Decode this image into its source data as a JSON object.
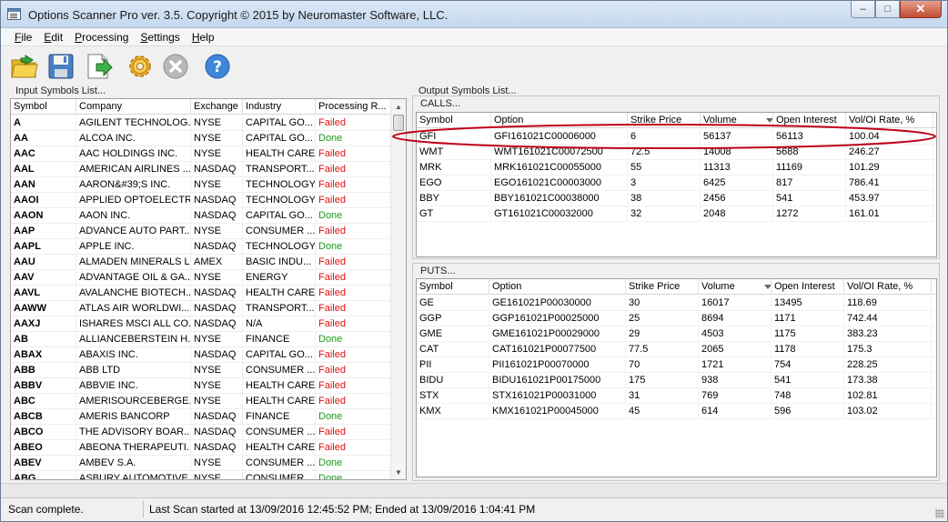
{
  "window": {
    "title": "Options Scanner Pro ver. 3.5. Copyright © 2015 by Neuromaster Software, LLC.",
    "controls": {
      "minimize": "–",
      "maximize": "□",
      "close": "✕"
    }
  },
  "menu": [
    {
      "ul": "F",
      "rest": "ile"
    },
    {
      "ul": "E",
      "rest": "dit"
    },
    {
      "ul": "P",
      "rest": "rocessing"
    },
    {
      "ul": "S",
      "rest": "ettings"
    },
    {
      "ul": "H",
      "rest": "elp"
    }
  ],
  "toolbar": [
    "open-folder-icon",
    "save-icon",
    "export-icon",
    "settings-gear-icon",
    "stop-icon",
    "help-icon"
  ],
  "input_panel": {
    "label": "Input Symbols List...",
    "columns": [
      "Symbol",
      "Company",
      "Exchange",
      "Industry",
      "Processing R..."
    ],
    "rows": [
      [
        "A",
        "AGILENT TECHNOLOG...",
        "NYSE",
        "CAPITAL GO...",
        "Failed"
      ],
      [
        "AA",
        "ALCOA INC.",
        "NYSE",
        "CAPITAL GO...",
        "Done"
      ],
      [
        "AAC",
        "AAC HOLDINGS INC.",
        "NYSE",
        "HEALTH CARE",
        "Failed"
      ],
      [
        "AAL",
        "AMERICAN AIRLINES ...",
        "NASDAQ",
        "TRANSPORT...",
        "Failed"
      ],
      [
        "AAN",
        "AARON&#39;S INC.",
        "NYSE",
        "TECHNOLOGY",
        "Failed"
      ],
      [
        "AAOI",
        "APPLIED OPTOELECTR...",
        "NASDAQ",
        "TECHNOLOGY",
        "Failed"
      ],
      [
        "AAON",
        "AAON INC.",
        "NASDAQ",
        "CAPITAL GO...",
        "Done"
      ],
      [
        "AAP",
        "ADVANCE AUTO PART...",
        "NYSE",
        "CONSUMER ...",
        "Failed"
      ],
      [
        "AAPL",
        "APPLE INC.",
        "NASDAQ",
        "TECHNOLOGY",
        "Done"
      ],
      [
        "AAU",
        "ALMADEN MINERALS L...",
        "AMEX",
        "BASIC INDU...",
        "Failed"
      ],
      [
        "AAV",
        "ADVANTAGE OIL & GA...",
        "NYSE",
        "ENERGY",
        "Failed"
      ],
      [
        "AAVL",
        "AVALANCHE BIOTECH...",
        "NASDAQ",
        "HEALTH CARE",
        "Failed"
      ],
      [
        "AAWW",
        "ATLAS AIR WORLDWI...",
        "NASDAQ",
        "TRANSPORT...",
        "Failed"
      ],
      [
        "AAXJ",
        "ISHARES MSCI ALL CO...",
        "NASDAQ",
        "N/A",
        "Failed"
      ],
      [
        "AB",
        "ALLIANCEBERSTEIN H...",
        "NYSE",
        "FINANCE",
        "Done"
      ],
      [
        "ABAX",
        "ABAXIS INC.",
        "NASDAQ",
        "CAPITAL GO...",
        "Failed"
      ],
      [
        "ABB",
        "ABB LTD",
        "NYSE",
        "CONSUMER ...",
        "Failed"
      ],
      [
        "ABBV",
        "ABBVIE INC.",
        "NYSE",
        "HEALTH CARE",
        "Failed"
      ],
      [
        "ABC",
        "AMERISOURCEBERGE...",
        "NYSE",
        "HEALTH CARE",
        "Failed"
      ],
      [
        "ABCB",
        "AMERIS BANCORP",
        "NASDAQ",
        "FINANCE",
        "Done"
      ],
      [
        "ABCO",
        "THE ADVISORY BOAR...",
        "NASDAQ",
        "CONSUMER ...",
        "Failed"
      ],
      [
        "ABEO",
        "ABEONA THERAPEUTI...",
        "NASDAQ",
        "HEALTH CARE",
        "Failed"
      ],
      [
        "ABEV",
        "AMBEV S.A.",
        "NYSE",
        "CONSUMER ...",
        "Done"
      ],
      [
        "ABG",
        "ASBURY AUTOMOTIVE ...",
        "NYSE",
        "CONSUMER ...",
        "Done"
      ]
    ]
  },
  "output_panel": {
    "label": "Output Symbols List...",
    "calls": {
      "label": "CALLS...",
      "columns": [
        "Symbol",
        "Option",
        "Strike Price",
        "Volume",
        "Open Interest",
        "Vol/OI Rate, %"
      ],
      "rows": [
        [
          "GFI",
          "GFI161021C00006000",
          "6",
          "56137",
          "56113",
          "100.04"
        ],
        [
          "WMT",
          "WMT161021C00072500",
          "72.5",
          "14008",
          "5688",
          "246.27"
        ],
        [
          "MRK",
          "MRK161021C00055000",
          "55",
          "11313",
          "11169",
          "101.29"
        ],
        [
          "EGO",
          "EGO161021C00003000",
          "3",
          "6425",
          "817",
          "786.41"
        ],
        [
          "BBY",
          "BBY161021C00038000",
          "38",
          "2456",
          "541",
          "453.97"
        ],
        [
          "GT",
          "GT161021C00032000",
          "32",
          "2048",
          "1272",
          "161.01"
        ]
      ]
    },
    "puts": {
      "label": "PUTS...",
      "columns": [
        "Symbol",
        "Option",
        "Strike Price",
        "Volume",
        "Open Interest",
        "Vol/OI Rate, %"
      ],
      "rows": [
        [
          "GE",
          "GE161021P00030000",
          "30",
          "16017",
          "13495",
          "118.69"
        ],
        [
          "GGP",
          "GGP161021P00025000",
          "25",
          "8694",
          "1171",
          "742.44"
        ],
        [
          "GME",
          "GME161021P00029000",
          "29",
          "4503",
          "1175",
          "383.23"
        ],
        [
          "CAT",
          "CAT161021P00077500",
          "77.5",
          "2065",
          "1178",
          "175.3"
        ],
        [
          "PII",
          "PII161021P00070000",
          "70",
          "1721",
          "754",
          "228.25"
        ],
        [
          "BIDU",
          "BIDU161021P00175000",
          "175",
          "938",
          "541",
          "173.38"
        ],
        [
          "STX",
          "STX161021P00031000",
          "31",
          "769",
          "748",
          "102.81"
        ],
        [
          "KMX",
          "KMX161021P00045000",
          "45",
          "614",
          "596",
          "103.02"
        ]
      ]
    }
  },
  "status": {
    "left": "Scan complete.",
    "right": "Last Scan started at 13/09/2016 12:45:52 PM; Ended at 13/09/2016 1:04:41 PM"
  },
  "colors": {
    "failed": "#e01010",
    "done": "#1a9a1a",
    "highlight": "#c0001a"
  }
}
